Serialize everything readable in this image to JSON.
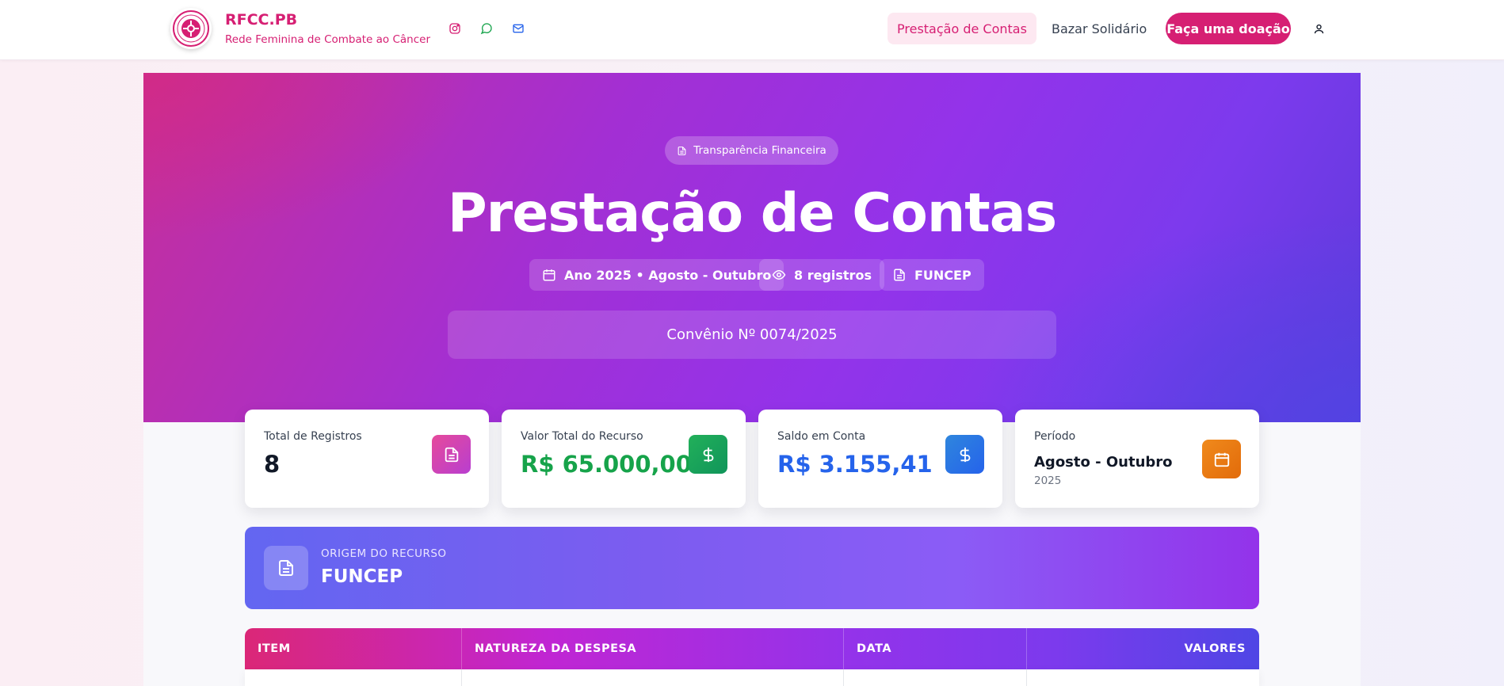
{
  "header": {
    "brand_title": "RFCC.PB",
    "brand_subtitle": "Rede Feminina de Combate ao Câncer",
    "social_icons": [
      "instagram-icon",
      "whatsapp-icon",
      "mail-icon"
    ],
    "nav": {
      "prestacao_label": "Prestação de Contas",
      "bazar_label": "Bazar Solidário",
      "donate_label": "Faça uma doação"
    }
  },
  "hero": {
    "badge": "Transparência Financeira",
    "title": "Prestação de Contas",
    "chips": {
      "period": "Ano 2025 • Agosto - Outubro",
      "records": "8 registros",
      "source": "FUNCEP"
    },
    "convenio": "Convênio Nº 0074/2025"
  },
  "stats": {
    "total_registros": {
      "label": "Total de Registros",
      "value": "8"
    },
    "valor_total": {
      "label": "Valor Total do Recurso",
      "value": "R$ 65.000,00"
    },
    "saldo": {
      "label": "Saldo em Conta",
      "value": "R$ 3.155,41"
    },
    "periodo": {
      "label": "Período",
      "value": "Agosto - Outubro",
      "sub": "2025"
    }
  },
  "origem": {
    "label": "ORIGEM DO RECURSO",
    "value": "FUNCEP"
  },
  "table": {
    "headers": {
      "item": "ITEM",
      "natureza": "NATUREZA DA DESPESA",
      "data": "DATA",
      "valores": "VALORES"
    }
  },
  "colors": {
    "brand_pink": "#d61f73",
    "green": "#16a34a",
    "blue": "#2563eb",
    "orange": "#ea780e"
  }
}
